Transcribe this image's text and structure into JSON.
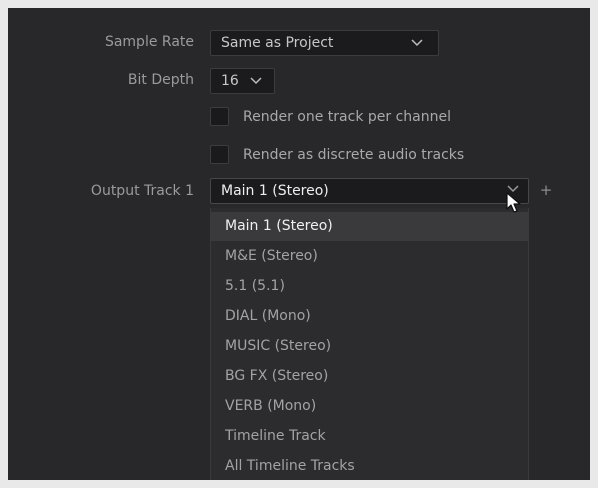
{
  "sample_rate": {
    "label": "Sample Rate",
    "value": "Same as Project"
  },
  "bit_depth": {
    "label": "Bit Depth",
    "value": "16"
  },
  "options": [
    {
      "label": "Render one track per channel",
      "checked": false
    },
    {
      "label": "Render as discrete audio tracks",
      "checked": false
    }
  ],
  "output_track": {
    "label": "Output Track 1",
    "value": "Main 1 (Stereo)",
    "add_icon": "plus-icon",
    "menu_items": [
      "Main 1 (Stereo)",
      "M&E (Stereo)",
      "5.1 (5.1)",
      "DIAL (Mono)",
      "MUSIC (Stereo)",
      "BG FX (Stereo)",
      "VERB (Mono)",
      "Timeline Track",
      "All Timeline Tracks"
    ],
    "highlighted_index": 0
  },
  "colors": {
    "panel_background": "#28282b",
    "field_background": "#1b1b1d",
    "menu_background": "#2c2c2f",
    "menu_highlight": "#3a3a3d"
  }
}
